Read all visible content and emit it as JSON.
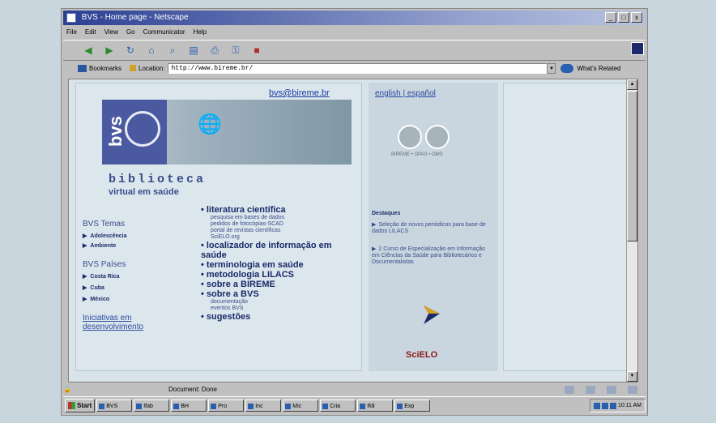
{
  "window": {
    "title": "BVS - Home page - Netscape",
    "controls": [
      "_",
      "□",
      "x"
    ]
  },
  "menu": [
    "File",
    "Edit",
    "View",
    "Go",
    "Communicator",
    "Help"
  ],
  "location_bar": {
    "bookmarks_label": "Bookmarks",
    "location_label": "Location:",
    "url": "http://www.bireme.br/",
    "related_label": "What's Related"
  },
  "page": {
    "email": "bvs@bireme.br",
    "brand": {
      "logo_text": "bvs",
      "title": "biblioteca",
      "subtitle": "virtual em saúde"
    },
    "temas": {
      "heading": "BVS Temas",
      "items": [
        "Adolescência",
        "Ambiente"
      ]
    },
    "paises": {
      "heading": "BVS Países",
      "items": [
        "Costa Rica",
        "Cuba",
        "México"
      ]
    },
    "iniciativas": [
      "Iniciativas em",
      "desenvolvimento"
    ],
    "main_links": [
      {
        "label": "literatura científica",
        "subs": [
          "pesquisa em bases de dados",
          "pedidos de fotocópias-SCAD",
          "portal de revistas científicas",
          "SciELO.org"
        ]
      },
      {
        "label": "localizador de informação em saúde",
        "subs": []
      },
      {
        "label": "terminologia em saúde",
        "subs": []
      },
      {
        "label": "metodologia LILACS",
        "subs": []
      },
      {
        "label": "sobre a BIREME",
        "subs": []
      },
      {
        "label": "sobre a BVS",
        "subs": [
          "documentação",
          "eventos BVS"
        ]
      },
      {
        "label": "sugestões",
        "subs": []
      }
    ],
    "languages": "english | español",
    "orgs": "BIREME • OPAS • OMS",
    "destaques": {
      "heading": "Destaques",
      "items": [
        "Seleção de novos periódicos para base de dados LILACS",
        "2 Curso de Especialização em Informação em Ciências da Saúde para Bibliotecários e Documentalistas"
      ]
    },
    "scielo": "SciELO"
  },
  "status": {
    "text": "Document: Done"
  },
  "taskbar": {
    "start": "Start",
    "tasks": [
      "BVS",
      "Ifab",
      "BH",
      "Pro",
      "Inc",
      "Mic",
      "Cria",
      "Ifdi",
      "Exp"
    ],
    "clock": "10:11 AM"
  }
}
